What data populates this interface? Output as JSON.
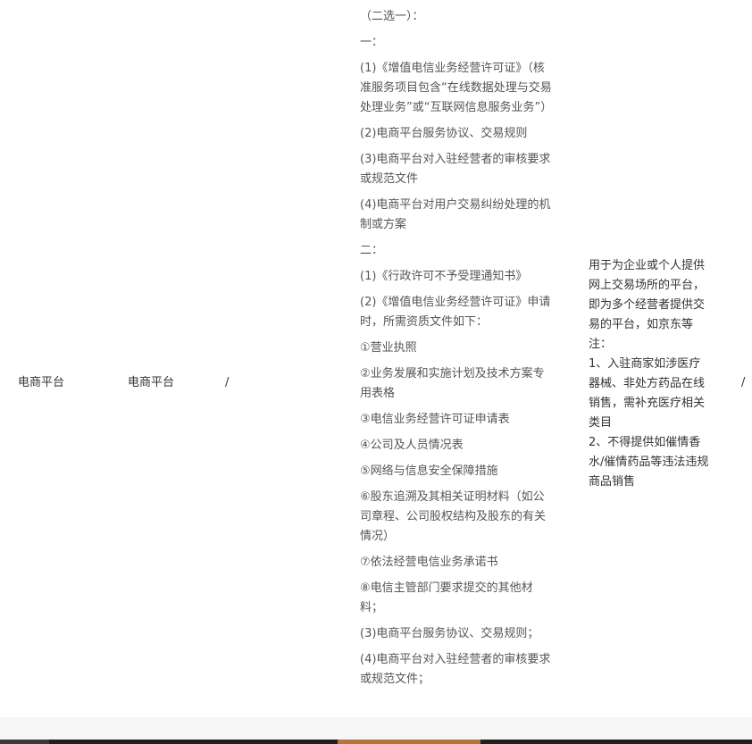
{
  "table_row": {
    "platform_type": "电商平台",
    "platform_name": "电商平台",
    "col3": "/",
    "materials": [
      "（二选一）：",
      "一：",
      "(1)《增值电信业务经营许可证》（核准服务项目包含“在线数据处理与交易处理业务”或“互联网信息服务业务”）",
      "(2)电商平台服务协议、交易规则",
      "(3)电商平台对入驻经营者的审核要求或规范文件",
      "(4)电商平台对用户交易纠纷处理的机制或方案",
      "二：",
      "(1)《行政许可不予受理通知书》",
      "(2)《增值电信业务经营许可证》申请时，所需资质文件如下：",
      "①营业执照",
      "②业务发展和实施计划及技术方案专用表格",
      "③电信业务经营许可证申请表",
      "④公司及人员情况表",
      "⑤网络与信息安全保障措施",
      "⑥股东追溯及其相关证明材料（如公司章程、公司股权结构及股东的有关情况）",
      "⑦依法经营电信业务承诺书",
      "⑧电信主管部门要求提交的其他材料；",
      "(3)电商平台服务协议、交易规则；",
      "(4)电商平台对入驻经营者的审核要求或规范文件；"
    ],
    "description": [
      "用于为企业或个人提供网上交易场所的平台，即为多个经营者提供交易的平台，如京东等",
      "注：",
      "1、入驻商家如涉医疗器械、非处方药品在线销售，需补充医疗相关类目",
      "2、不得提供如催情香水/催情药品等违法违规商品销售"
    ],
    "col6": "/"
  },
  "colors": {
    "text": "#333333",
    "materials_text": "#555555",
    "footer_bg": "#f6f6f6",
    "bottom_bar": "#1f1f1f",
    "accent": "#b5743c"
  }
}
